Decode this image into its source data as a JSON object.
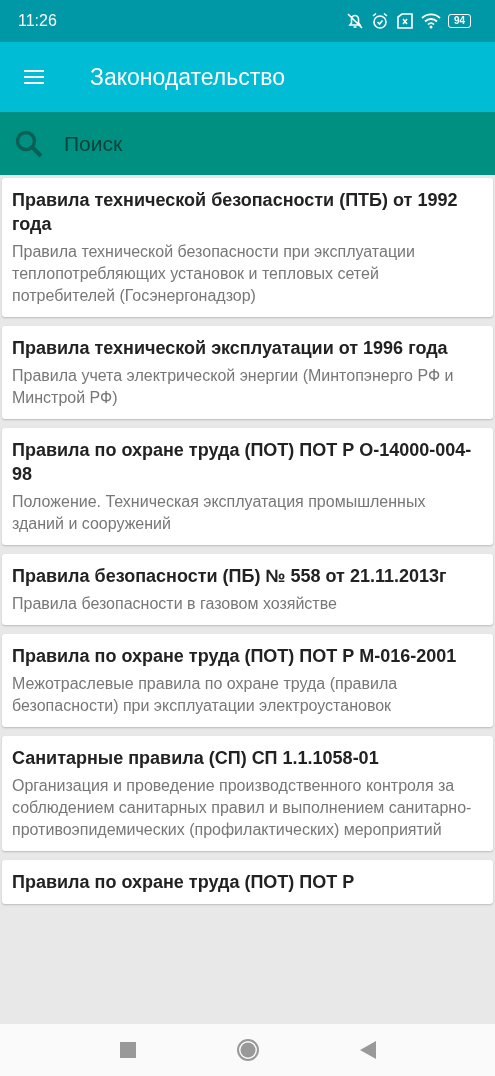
{
  "status_bar": {
    "time": "11:26",
    "battery": "94"
  },
  "app_bar": {
    "title": "Законодательство"
  },
  "search": {
    "placeholder": "Поиск"
  },
  "documents": [
    {
      "title": "Правила технической безопасности (ПТБ) от 1992 года",
      "description": "Правила технической безопасности при эксплуатации теплопотребляющих установок и тепловых сетей потребителей (Госэнергонадзор)"
    },
    {
      "title": "Правила технической эксплуатации от 1996 года",
      "description": "Правила учета электрической энергии (Минтопэнерго РФ и Минстрой РФ)"
    },
    {
      "title": "Правила по охране труда (ПОТ) ПОТ Р О-14000-004-98",
      "description": "Положение. Техническая эксплуатация промышленных зданий и сооружений"
    },
    {
      "title": "Правила безопасности (ПБ) № 558 от 21.11.2013г",
      "description": "Правила безопасности в газовом хозяйстве"
    },
    {
      "title": "Правила по охране труда (ПОТ) ПОТ Р М-016-2001",
      "description": "Межотраслевые правила по охране труда (правила безопасности) при эксплуатации электроустановок"
    },
    {
      "title": "Санитарные правила (СП) СП 1.1.1058-01",
      "description": "Организация и проведение производственного контроля за соблюдением санитарных правил и выполнением санитарно-противоэпидемических (профилактических) мероприятий"
    },
    {
      "title": "Правила по охране труда (ПОТ) ПОТ Р"
    }
  ]
}
